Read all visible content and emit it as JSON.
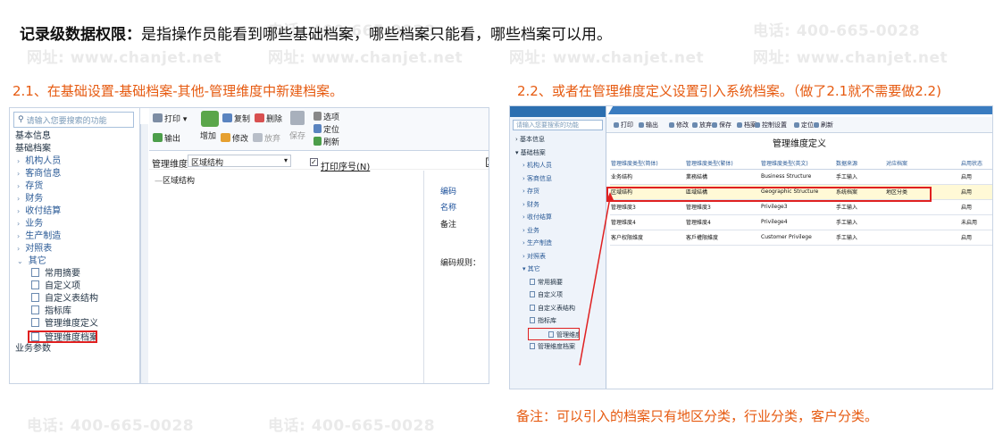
{
  "heading": {
    "bold": "记录级数据权限：",
    "text": "是指操作员能看到哪些基础档案，哪些档案只能看，哪些档案可以用。"
  },
  "step_left": "2.1、在基础设置-基础档案-其他-管理维度中新建档案。",
  "step_right": "2.2、或者在管理维度定义设置引入系统档案。（做了2.1就不需要做2.2)",
  "note": "备注：可以引入的档案只有地区分类，行业分类，客户分类。",
  "watermark": {
    "phone": "电话: 400-665-0028",
    "site": "网址: www.chanjet.net"
  },
  "left_ui": {
    "search_placeholder": "请输入您要搜索的功能",
    "nav": [
      {
        "label": "基本信息",
        "kind": "sec"
      },
      {
        "label": "基础档案",
        "kind": "sec"
      },
      {
        "label": "机构人员",
        "kind": "it"
      },
      {
        "label": "客商信息",
        "kind": "it"
      },
      {
        "label": "存货",
        "kind": "it"
      },
      {
        "label": "财务",
        "kind": "it"
      },
      {
        "label": "收付结算",
        "kind": "it"
      },
      {
        "label": "业务",
        "kind": "it"
      },
      {
        "label": "生产制造",
        "kind": "it"
      },
      {
        "label": "对照表",
        "kind": "it"
      },
      {
        "label": "其它",
        "kind": "open"
      },
      {
        "label": "常用摘要",
        "kind": "sub"
      },
      {
        "label": "自定义项",
        "kind": "sub"
      },
      {
        "label": "自定义表结构",
        "kind": "sub"
      },
      {
        "label": "指标库",
        "kind": "sub"
      },
      {
        "label": "管理维度定义",
        "kind": "sub"
      },
      {
        "label": "管理维度档案",
        "kind": "hl"
      },
      {
        "label": "业务参数",
        "kind": "sec"
      }
    ],
    "toolbar": {
      "print": "打印",
      "output": "输出",
      "add": "增加",
      "copy": "复制",
      "delete": "删除",
      "edit": "修改",
      "abandon": "放弃",
      "save": "保存",
      "options": "选项",
      "locate": "定位",
      "refresh": "刷新"
    },
    "filter": {
      "label": "管理维度",
      "value": "区域结构",
      "print_seq": "打印序号(N)",
      "right_char": "区"
    },
    "tree_root": "区域结构",
    "props": {
      "code": "编码",
      "name": "名称",
      "remark": "备注",
      "code_rule": "编码规则："
    }
  },
  "right_ui": {
    "search_placeholder": "请输入您要搜索的功能",
    "nav": [
      {
        "label": "基本信息",
        "kind": "l1"
      },
      {
        "label": "基础档案",
        "kind": "l1"
      },
      {
        "label": "机构人员",
        "kind": "l2"
      },
      {
        "label": "客商信息",
        "kind": "l2"
      },
      {
        "label": "存货",
        "kind": "l2"
      },
      {
        "label": "财务",
        "kind": "l2"
      },
      {
        "label": "收付结算",
        "kind": "l2"
      },
      {
        "label": "业务",
        "kind": "l2"
      },
      {
        "label": "生产制造",
        "kind": "l2"
      },
      {
        "label": "对照表",
        "kind": "l2"
      },
      {
        "label": "其它",
        "kind": "l2"
      },
      {
        "label": "常用摘要",
        "kind": "l3"
      },
      {
        "label": "自定义项",
        "kind": "l3"
      },
      {
        "label": "自定义表结构",
        "kind": "l3"
      },
      {
        "label": "指标库",
        "kind": "l3"
      },
      {
        "label": "管理维度定义",
        "kind": "hl"
      },
      {
        "label": "管理维度档案",
        "kind": "l3"
      }
    ],
    "toolbar": [
      "打印",
      "输出",
      "修改",
      "放弃",
      "保存",
      "档案",
      "控制设置",
      "定位",
      "刷新"
    ],
    "title": "管理维度定义",
    "columns": [
      "管理维度类型(简体)",
      "管理维度类型(繁体)",
      "管理维度类型(英文)",
      "数据来源",
      "对应档案",
      "启用状态"
    ],
    "rows": [
      [
        "业务结构",
        "業務結構",
        "Business Structure",
        "手工输入",
        "",
        "启用"
      ],
      [
        "区域结构",
        "區域結構",
        "Geographic Structure",
        "系统档案",
        "地区分类",
        "启用"
      ],
      [
        "管理维度3",
        "管理維度3",
        "Privilege3",
        "手工输入",
        "",
        "启用"
      ],
      [
        "管理维度4",
        "管理維度4",
        "Privilege4",
        "手工输入",
        "",
        "未启用"
      ],
      [
        "客户权限维度",
        "客戶權限維度",
        "Customer Privilege",
        "手工输入",
        "",
        "启用"
      ]
    ]
  },
  "colors": {
    "accent": "#e65a10",
    "highlight": "#e02020",
    "link": "#2a5a96"
  }
}
